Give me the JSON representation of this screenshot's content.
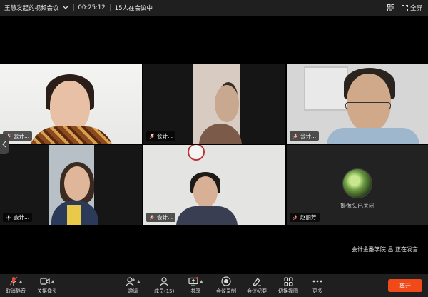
{
  "topbar": {
    "meeting_title": "王慧发起的视频会议",
    "elapsed": "00:25:12",
    "attendees": "15人在会议中",
    "fullscreen_label": "全屏"
  },
  "tiles": [
    {
      "name": "会计...",
      "mic": "muted"
    },
    {
      "name": "会计...",
      "mic": "muted"
    },
    {
      "name": "会计...",
      "mic": "muted"
    },
    {
      "name": "会计...",
      "mic": "on"
    },
    {
      "name": "会计...",
      "mic": "muted"
    },
    {
      "name": "赵丽芳",
      "mic": "muted",
      "camera_off_text": "摄像头已关闭"
    }
  ],
  "speaking_status": "会计金融学院 吕  正在发言",
  "toolbar": {
    "unmute": "取消静音",
    "camera_off": "关摄像头",
    "invite": "邀请",
    "members": "成员(15)",
    "share": "共享",
    "record": "会议录制",
    "minutes": "会议纪要",
    "switch_view": "切换视图",
    "more": "更多",
    "leave": "离开"
  },
  "colors": {
    "accent_green": "#3fbf5f",
    "leave_red": "#f04a1a",
    "mute_red": "#e0483a"
  }
}
